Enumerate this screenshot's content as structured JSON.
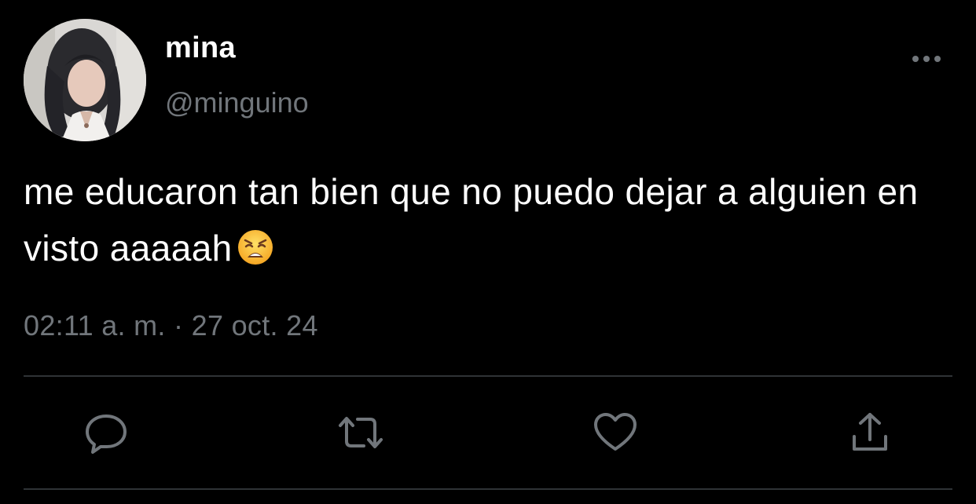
{
  "user": {
    "display_name": "mina",
    "handle": "@minguino",
    "avatar_icon": "profile-photo"
  },
  "tweet": {
    "text": "me educaron tan bien que no puedo dejar a alguien en visto aaaaah",
    "emoji": "weary-face-emoji",
    "time": "02:11 a. m.",
    "separator": "·",
    "date": "27 oct. 24"
  },
  "actions": {
    "more": "more-options-icon",
    "reply": "reply-icon",
    "retweet": "retweet-icon",
    "like": "like-icon",
    "share": "share-icon"
  },
  "colors": {
    "background": "#000000",
    "primary_text": "#ffffff",
    "secondary_text": "#71767b",
    "divider": "#2f3336",
    "icon": "#71767b"
  }
}
